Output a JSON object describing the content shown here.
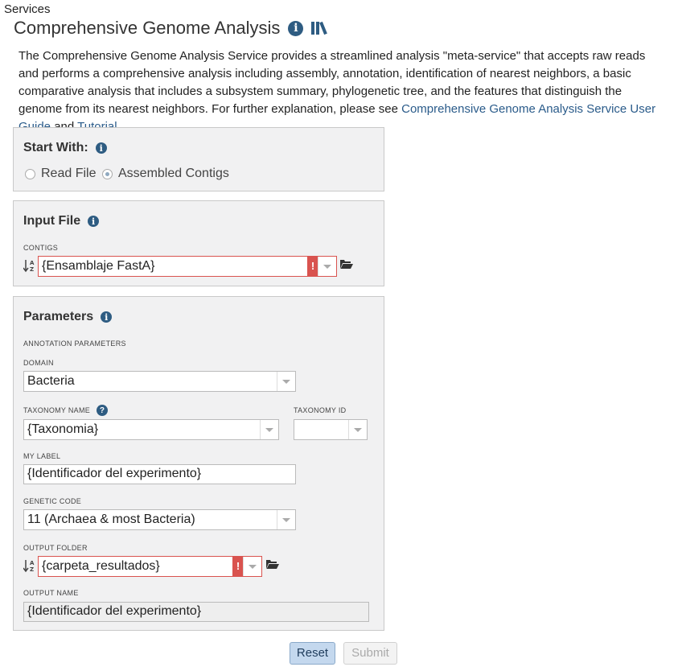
{
  "breadcrumb": "Services",
  "page_title": "Comprehensive Genome Analysis",
  "description": {
    "text": "The Comprehensive Genome Analysis Service provides a streamlined analysis \"meta-service\" that accepts raw reads and performs a comprehensive analysis including assembly, annotation, identification of nearest neighbors, a basic comparative analysis that includes a subsystem summary, phylogenetic tree, and the features that distinguish the genome from its nearest neighbors. For further explanation, please see ",
    "link_guide": "Comprehensive Genome Analysis Service User Guide",
    "and": " and ",
    "link_tutorial": "Tutorial",
    "end": "."
  },
  "start_with": {
    "heading": "Start With:",
    "option_read": "Read File",
    "option_contigs": "Assembled Contigs",
    "selected": "Assembled Contigs"
  },
  "input_file": {
    "heading": "Input File",
    "contigs_label": "CONTIGS",
    "contigs_value": "{Ensamblaje FastA}",
    "warning": "!"
  },
  "parameters": {
    "heading": "Parameters",
    "section_label": "ANNOTATION PARAMETERS",
    "domain_label": "DOMAIN",
    "domain_value": "Bacteria",
    "taxonomy_name_label": "TAXONOMY NAME",
    "taxonomy_name_value": "{Taxonomia}",
    "taxonomy_id_label": "TAXONOMY ID",
    "taxonomy_id_value": "",
    "my_label_label": "MY LABEL",
    "my_label_value": "{Identificador del experimento}",
    "genetic_code_label": "GENETIC CODE",
    "genetic_code_value": "11 (Archaea & most Bacteria)",
    "output_folder_label": "OUTPUT FOLDER",
    "output_folder_value": "{carpeta_resultados}",
    "output_name_label": "OUTPUT NAME",
    "output_name_value": "{Identificador del experimento}",
    "help": "?"
  },
  "buttons": {
    "reset": "Reset",
    "submit": "Submit"
  },
  "icons": {
    "info": "i",
    "sort_az": "A/Z sort icon"
  }
}
